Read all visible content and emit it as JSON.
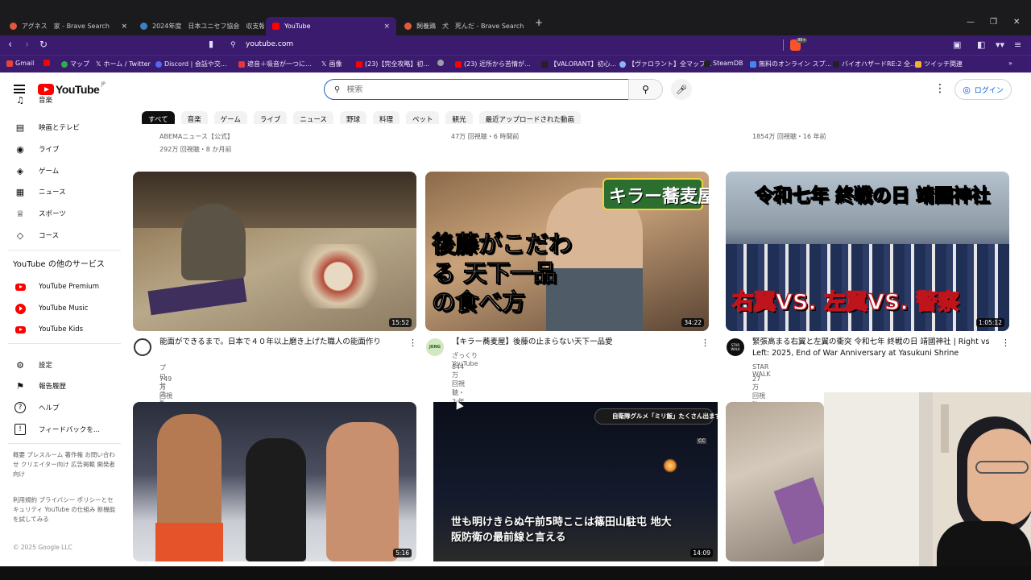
{
  "browser": {
    "tabs": [
      {
        "label": "アグネス　家 - Brave Search",
        "color": "#e05a3a"
      },
      {
        "label": "2024年度　日本ユニセフ協会　収支報",
        "color": "#3b82c4"
      },
      {
        "label": "YouTube",
        "color": "#ff0000"
      },
      {
        "label": "飼養鶏　犬　死んだ - Brave Search",
        "color": "#e05a3a"
      }
    ],
    "url": "youtube.com",
    "brave_badge": "99+",
    "bookmarks": [
      {
        "label": "Gmail",
        "color": "#ea4335"
      },
      {
        "label": "",
        "color": "#ff0000"
      },
      {
        "label": "マップ",
        "color": "#34a853"
      },
      {
        "label": "ホーム / Twitter",
        "color": "#ffffff"
      },
      {
        "label": "Discord | 会話や交...",
        "color": "#5865f2"
      },
      {
        "label": "遮音＋吸音が一つに...",
        "color": "#e0383e"
      },
      {
        "label": "画像",
        "color": "#ffffff"
      },
      {
        "label": "(23)【完全攻略】初...",
        "color": "#ff0000"
      },
      {
        "label": "",
        "color": "#9aa0a6"
      },
      {
        "label": "(23) 近所から苦情が...",
        "color": "#ff0000"
      },
      {
        "label": "【VALORANT】初心...",
        "color": "#222222"
      },
      {
        "label": "【ヴァロラント】全マップ...",
        "color": "#8ab4f8"
      },
      {
        "label": "SteamDB",
        "color": "#222222"
      },
      {
        "label": "無料のオンライン スプ...",
        "color": "#4285f4"
      },
      {
        "label": "バイオハザードRE:2 全...",
        "color": "#222222"
      },
      {
        "label": "ツイッチ関連",
        "color": "#f2b233"
      }
    ]
  },
  "youtube": {
    "logo_text": "YouTube",
    "region": "JP",
    "search_placeholder": "検索",
    "login_label": "ログイン",
    "chips": [
      "すべて",
      "音楽",
      "ゲーム",
      "ライブ",
      "ニュース",
      "野球",
      "料理",
      "ペット",
      "観光",
      "最近アップロードされた動画"
    ],
    "sidebar": {
      "top_items": [
        {
          "label": "音楽",
          "icon": "music-note-icon",
          "glyph": "♫"
        },
        {
          "label": "映画とテレビ",
          "icon": "film-icon",
          "glyph": "▤"
        },
        {
          "label": "ライブ",
          "icon": "live-icon",
          "glyph": "◉"
        },
        {
          "label": "ゲーム",
          "icon": "gamepad-icon",
          "glyph": "◈"
        },
        {
          "label": "ニュース",
          "icon": "newspaper-icon",
          "glyph": "▦"
        },
        {
          "label": "スポーツ",
          "icon": "trophy-icon",
          "glyph": "♕"
        },
        {
          "label": "コース",
          "icon": "learning-icon",
          "glyph": "◇"
        }
      ],
      "more_heading": "YouTube の他のサービス",
      "services": [
        "YouTube Premium",
        "YouTube Music",
        "YouTube Kids"
      ],
      "settings_items": [
        {
          "label": "設定",
          "icon": "gear-icon",
          "glyph": "⚙"
        },
        {
          "label": "報告履歴",
          "icon": "flag-icon",
          "glyph": "⚑"
        },
        {
          "label": "ヘルプ",
          "icon": "help-icon",
          "glyph": "?"
        },
        {
          "label": "フィードバックを...",
          "icon": "feedback-icon",
          "glyph": "!"
        }
      ],
      "footer1": "概要  プレスルーム  著作権  お問い合わせ  クリエイター向け  広告掲載  開発者向け",
      "footer2": "利用規約  プライバシー  ポリシーとセキュリティ  YouTube の仕組み  新機能を試してみる",
      "copyright": "© 2025 Google LLC"
    },
    "prev_row": [
      {
        "channel": "ABEMAニュース【公式】",
        "meta": "292万 回視聴・8 か月前"
      },
      {
        "channel": "",
        "meta": "47万 回視聴・6 時間前"
      },
      {
        "channel": "",
        "meta": "1854万 回視聴・16 年前"
      }
    ],
    "videos": [
      {
        "title": "能面ができるまで。日本で４０年以上磨き上げた職人の能面作り",
        "channel": "プロセスX",
        "verified": "✓",
        "meta": "749万 回視聴・2 年前",
        "duration": "15:52",
        "overlay": ""
      },
      {
        "title": "【キラー蕎麦屋】後藤の止まらない天下一品愛",
        "channel": "ざっくりYouTube",
        "verified": "",
        "meta": "844万 回視聴・2 年前",
        "duration": "34:22",
        "overlay": "後藤がこだわる 天下一品の食べ方",
        "badge": "キラー蕎麦屋",
        "avatar_text": "JKNG"
      },
      {
        "title": "緊張高まる右翼と左翼の衝突 令和七年 終戦の日 靖國神社 | Right vs Left: 2025, End of War Anniversary at Yasukuni Shrine",
        "channel": "STAR WALK",
        "verified": "",
        "meta": "27万 回視聴・2 週間前",
        "duration": "1:05:12",
        "overlay": "令和七年 終戦の日 靖國神社",
        "overlay2": "右翼VS. 左翼VS. 警察",
        "avatar_text": "STAR WALK"
      },
      {
        "title": "",
        "duration": "5:16"
      },
      {
        "title": "",
        "duration": "14:09",
        "overlay": "世も明けきらぬ午前5時ここは篠田山駐屯 地大阪防衛の最前線と言える",
        "overlay_small": "自衛隊グルメ「ミリ飯」たくさん出ます",
        "cc": "CC"
      },
      {
        "title": "",
        "duration": ""
      }
    ]
  }
}
